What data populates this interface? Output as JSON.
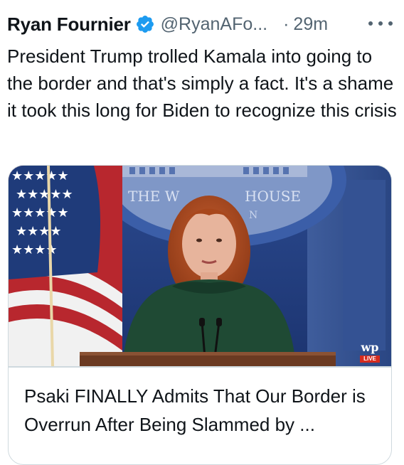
{
  "tweet": {
    "display_name": "Ryan Fournier",
    "verified_icon": "verified-badge-icon",
    "handle": "@RyanAFo...",
    "separator": "·",
    "time": "29m",
    "more_icon": "more-dots-icon",
    "text": "President Trump trolled Kamala into going to the border and that's simply a fact. It's a shame it took this long for Biden to recognize this crisis"
  },
  "card": {
    "image_sign_left": "THE W",
    "image_sign_right": "HOUSE",
    "image_sign_bottom": "N",
    "badge_logo": "wp",
    "badge_live": "LIVE",
    "title": "Psaki FINALLY Admits That Our Border is Overrun After Being Slammed by ..."
  },
  "colors": {
    "text": "#0f1419",
    "secondary": "#536471",
    "verified": "#1d9bf0",
    "border": "#cfd9de",
    "backdrop": "#2f4b86",
    "live": "#d62b1e"
  }
}
